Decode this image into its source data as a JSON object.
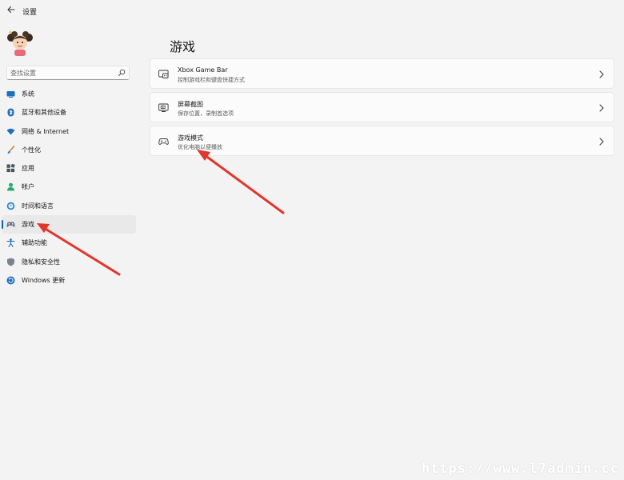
{
  "window": {
    "title": "设置"
  },
  "search": {
    "placeholder": "查找设置"
  },
  "sidebar": {
    "items": [
      {
        "label": "系统",
        "icon": "monitor-icon"
      },
      {
        "label": "蓝牙和其他设备",
        "icon": "bluetooth-icon"
      },
      {
        "label": "网络 & Internet",
        "icon": "wifi-icon"
      },
      {
        "label": "个性化",
        "icon": "brush-icon"
      },
      {
        "label": "应用",
        "icon": "apps-icon"
      },
      {
        "label": "帐户",
        "icon": "person-icon"
      },
      {
        "label": "时间和语言",
        "icon": "clock-globe-icon"
      },
      {
        "label": "游戏",
        "icon": "gamepad-icon",
        "selected": true
      },
      {
        "label": "辅助功能",
        "icon": "accessibility-icon"
      },
      {
        "label": "隐私和安全性",
        "icon": "shield-icon"
      },
      {
        "label": "Windows 更新",
        "icon": "update-icon"
      }
    ]
  },
  "main": {
    "title": "游戏",
    "cards": [
      {
        "title": "Xbox Game Bar",
        "subtitle": "控制游戏栏和键盘快捷方式",
        "icon": "game-bar-icon"
      },
      {
        "title": "屏幕截图",
        "subtitle": "保存位置，录制首选项",
        "icon": "capture-icon"
      },
      {
        "title": "游戏模式",
        "subtitle": "优化电脑以便播放",
        "icon": "game-mode-icon"
      }
    ]
  },
  "watermark": "https://www.l7admin.cc",
  "colors": {
    "accent": "#0067c0",
    "annotation_arrow": "#e0362c",
    "background": "#f3f3f3"
  }
}
